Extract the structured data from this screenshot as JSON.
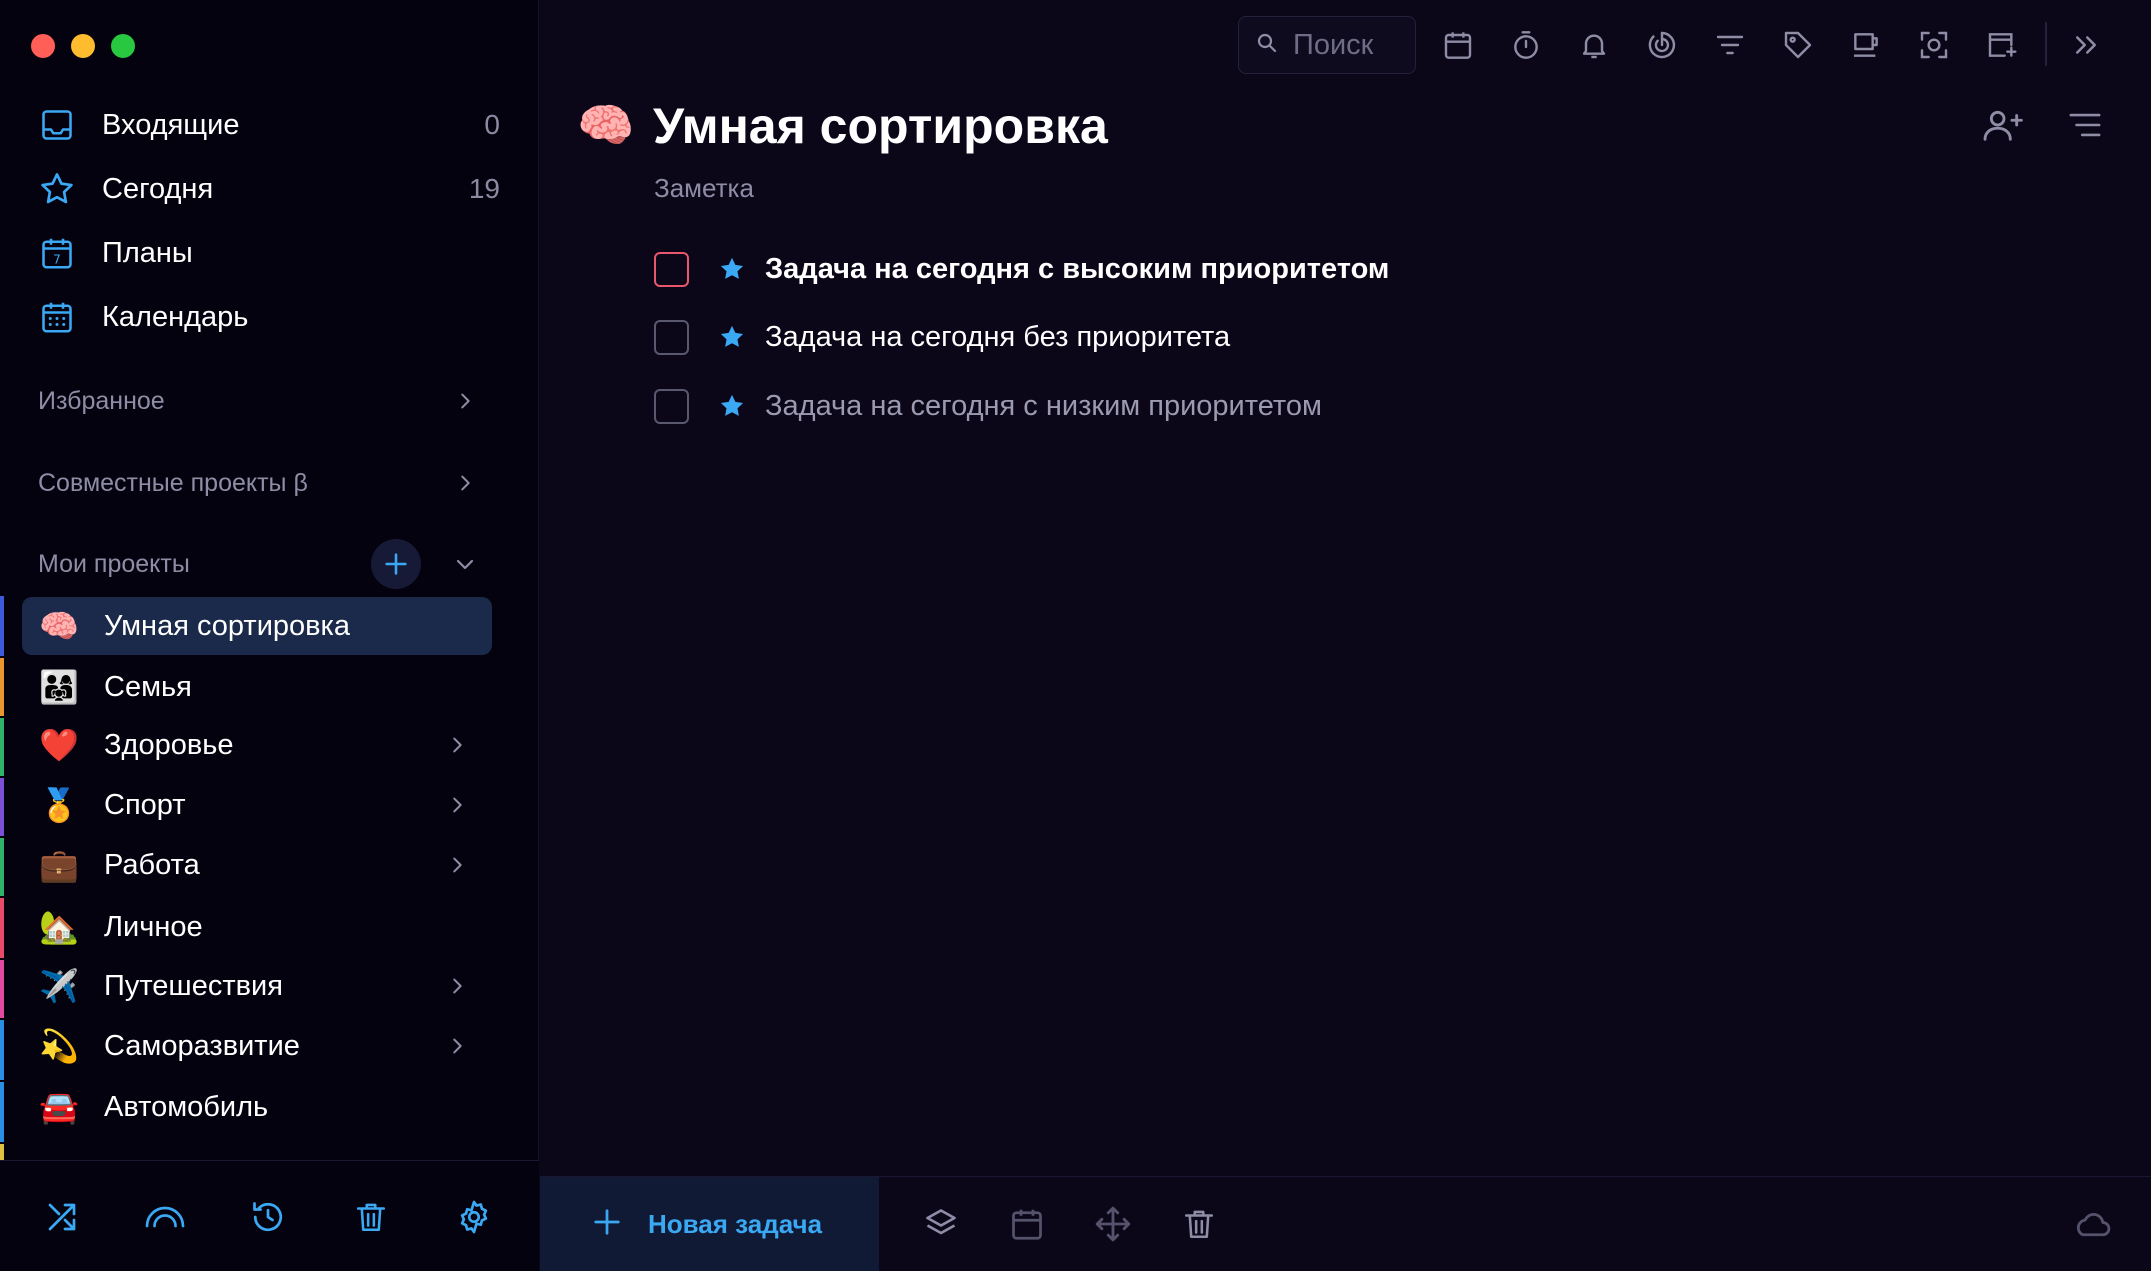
{
  "window": {
    "controls": [
      "close",
      "minimize",
      "zoom"
    ]
  },
  "sidebar": {
    "nav": [
      {
        "label": "Входящие",
        "count": "0",
        "icon": "inbox-icon"
      },
      {
        "label": "Сегодня",
        "count": "19",
        "icon": "star-icon"
      },
      {
        "label": "Планы",
        "count": "",
        "icon": "calendar-7-icon"
      },
      {
        "label": "Календарь",
        "count": "",
        "icon": "calendar-grid-icon"
      }
    ],
    "sections": {
      "favorites": "Избранное",
      "shared": "Совместные проекты β",
      "my_projects": "Мои проекты"
    },
    "projects": [
      {
        "label": "Умная сортировка",
        "emoji": "🧠",
        "active": true,
        "has_children": false,
        "color": "#3b5bdb"
      },
      {
        "label": "Семья",
        "emoji": "👨‍👩‍👧",
        "active": false,
        "has_children": false,
        "color": "#e8962e"
      },
      {
        "label": "Здоровье",
        "emoji": "❤️",
        "active": false,
        "has_children": true,
        "color": "#2fb36a"
      },
      {
        "label": "Спорт",
        "emoji": "🏅",
        "active": false,
        "has_children": true,
        "color": "#7b4fd6"
      },
      {
        "label": "Работа",
        "emoji": "💼",
        "active": false,
        "has_children": true,
        "color": "#2fb36a"
      },
      {
        "label": "Личное",
        "emoji": "🏡",
        "active": false,
        "has_children": false,
        "color": "#e84a6a"
      },
      {
        "label": "Путешествия",
        "emoji": "✈️",
        "active": false,
        "has_children": true,
        "color": "#e04aa0"
      },
      {
        "label": "Саморазвитие",
        "emoji": "💫",
        "active": false,
        "has_children": true,
        "color": "#2a8fe0"
      },
      {
        "label": "Автомобиль",
        "emoji": "🚘",
        "active": false,
        "has_children": false,
        "color": "#2a8fe0"
      }
    ],
    "bottom_icons": [
      "shuffle-icon",
      "rainbow-icon",
      "history-icon",
      "trash-icon",
      "settings-icon"
    ]
  },
  "toolbar": {
    "search_placeholder": "Поиск",
    "icons": [
      "calendar-icon",
      "timer-icon",
      "bell-icon",
      "pomodoro-icon",
      "filter-icon",
      "tag-icon",
      "coffee-icon",
      "focus-icon",
      "add-calendar-icon",
      "collapse-icon"
    ]
  },
  "main": {
    "emoji": "🧠",
    "title": "Умная сортировка",
    "note": "Заметка",
    "header_icons": [
      "add-member-icon",
      "sort-icon"
    ],
    "tasks": [
      {
        "label": "Задача на сегодня с высоким приоритетом",
        "priority": "high",
        "starred": true
      },
      {
        "label": "Задача на сегодня без приоритета",
        "priority": "none",
        "starred": true
      },
      {
        "label": "Задача на сегодня с низким приоритетом",
        "priority": "low",
        "starred": true
      }
    ]
  },
  "bottom_bar": {
    "new_task_label": "Новая задача",
    "icons": [
      "layers-icon",
      "calendar-icon",
      "move-icon",
      "trash-icon",
      "cloud-icon"
    ]
  },
  "colors": {
    "accent": "#3ba8f4",
    "high_priority": "#e8576c",
    "background": "#0b0719",
    "sidebar_background": "#05020f",
    "active_item": "#1b2a4a"
  }
}
